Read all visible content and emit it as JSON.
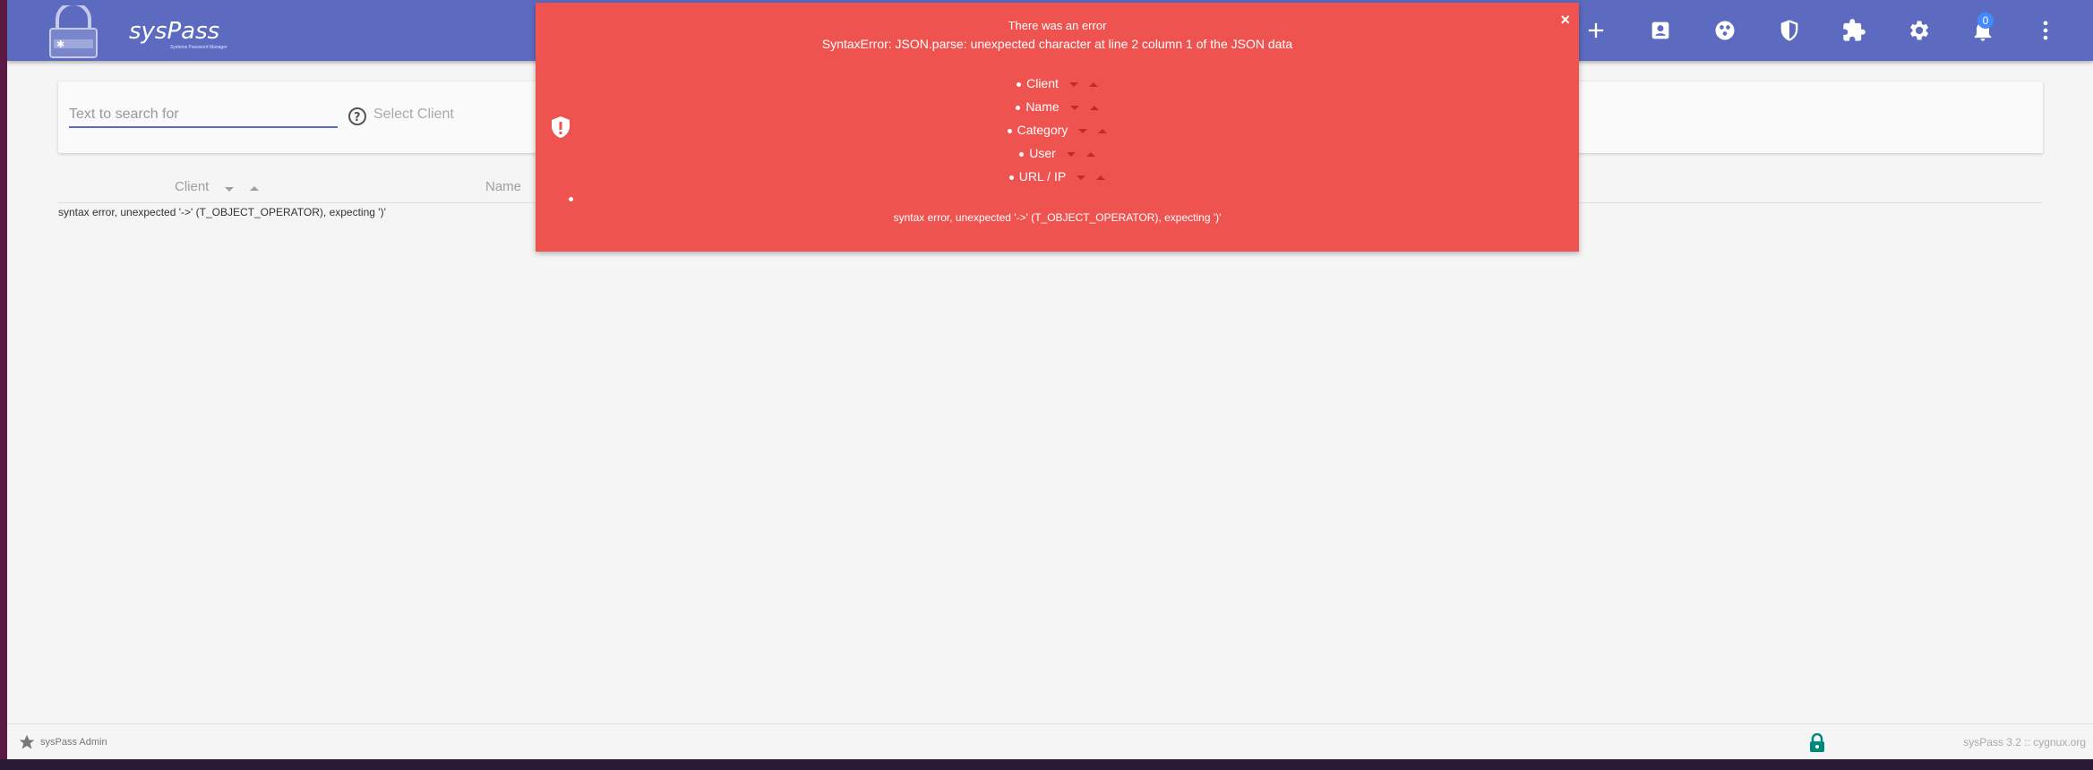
{
  "header": {
    "brand": "sysPass",
    "brand_subtitle": "Systems Password Manager",
    "notifications_count": "0",
    "icons": [
      "add-icon",
      "account-box-icon",
      "groups-icon",
      "security-shield-icon",
      "extension-icon",
      "settings-gear-icon",
      "notifications-bell-icon",
      "more-vert-icon"
    ],
    "accent_color": "#5c6bc0"
  },
  "search": {
    "placeholder": "Text to search for",
    "select_client_placeholder": "Select Client"
  },
  "results": {
    "columns": [
      "Client",
      "Name"
    ],
    "error_text": "syntax error, unexpected '->' (T_OBJECT_OPERATOR), expecting ')'"
  },
  "error_popup": {
    "title": "There was an error",
    "message": "SyntaxError: JSON.parse: unexpected character at line 2 column 1 of the JSON data",
    "sort_items": [
      "Client",
      "Name",
      "Category",
      "User",
      "URL / IP"
    ],
    "detail": "syntax error, unexpected '->' (T_OBJECT_OPERATOR), expecting ')'",
    "close_label": "×",
    "color": "#ef5350"
  },
  "footer": {
    "user": "sysPass Admin",
    "version": "sysPass 3.2  ::  cygnux.org"
  }
}
